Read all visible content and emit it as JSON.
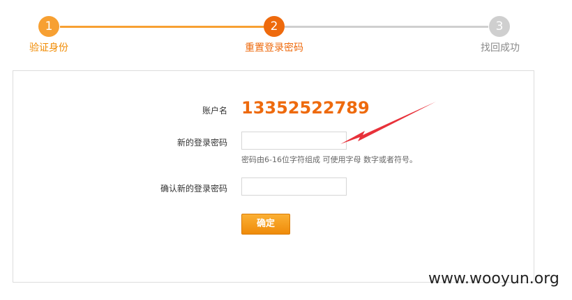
{
  "steps": [
    {
      "number": "1",
      "label": "验证身份"
    },
    {
      "number": "2",
      "label": "重置登录密码"
    },
    {
      "number": "3",
      "label": "找回成功"
    }
  ],
  "form": {
    "account_label": "账户名",
    "account_value": "13352522789",
    "new_password_label": "新的登录密码",
    "new_password_value": "",
    "password_hint": "密码由6-16位字符组成 可使用字母 数字或者符号。",
    "confirm_password_label": "确认新的登录密码",
    "confirm_password_value": "",
    "submit_label": "确定"
  },
  "watermark": "www.wooyun.org",
  "colors": {
    "step_done": "#f7a032",
    "step_active": "#ee6a0d",
    "step_pending": "#cfcfcf",
    "account_value": "#ee6a0d",
    "annotation_arrow": "#e8313a"
  }
}
